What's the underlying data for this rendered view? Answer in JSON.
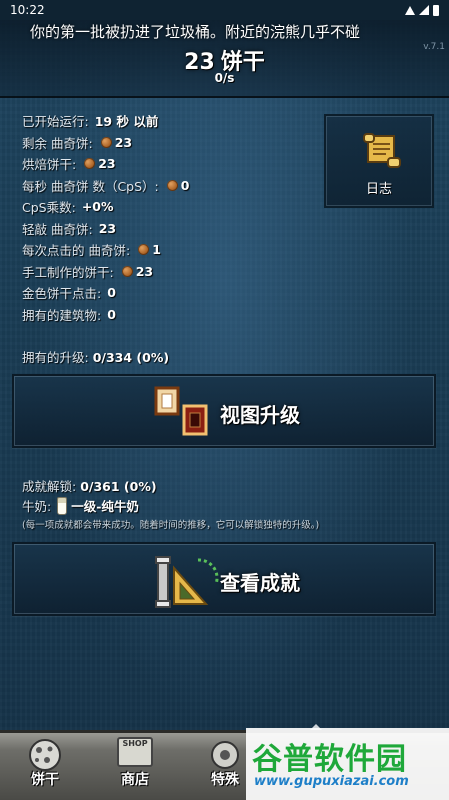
{
  "status_bar": {
    "time": "10:22"
  },
  "header": {
    "ticker": "你的第一批被扔进了垃圾桶。附近的浣熊几乎不碰",
    "version": "v.7.1",
    "cookie_number": "23",
    "cookie_unit": "饼干",
    "per_second": "0/s"
  },
  "stats": [
    {
      "label": "已开始运行:",
      "value": "19 秒 以前",
      "cookie_icon": false
    },
    {
      "label": "剩余 曲奇饼:",
      "value": "23",
      "cookie_icon": true
    },
    {
      "label": "烘焙饼干:",
      "value": "23",
      "cookie_icon": true
    },
    {
      "label": "每秒 曲奇饼 数（CpS）:",
      "value": "0",
      "cookie_icon": true
    },
    {
      "label": "CpS乘数:",
      "value": "+0%",
      "cookie_icon": false
    },
    {
      "label": "轻敲 曲奇饼:",
      "value": "23",
      "cookie_icon": false
    },
    {
      "label": "每次点击的 曲奇饼:",
      "value": "1",
      "cookie_icon": true
    },
    {
      "label": "手工制作的饼干:",
      "value": "23",
      "cookie_icon": true
    },
    {
      "label": "金色饼干点击:",
      "value": "0",
      "cookie_icon": false
    },
    {
      "label": "拥有的建筑物:",
      "value": "0",
      "cookie_icon": false
    }
  ],
  "log_button": {
    "label": "日志",
    "icon": "scroll-icon"
  },
  "upgrades": {
    "label": "拥有的升级:",
    "value": "0/334 (0%)",
    "button_label": "视图升级",
    "icon": "upgrade-frames-icon"
  },
  "achievements": {
    "label": "成就解锁:",
    "value": "0/361 (0%)",
    "milk_label": "牛奶:",
    "milk_value": "一级-纯牛奶",
    "note": "(每一项成就都会带来成功。随着时间的推移，它可以解锁独特的升级。)",
    "button_label": "查看成就",
    "icon": "trophy-ruler-icon"
  },
  "bottom_tabs": [
    {
      "label": "饼干",
      "icon": "cookie-icon"
    },
    {
      "label": "商店",
      "icon": "shop-icon",
      "icon_text": "SHOP"
    },
    {
      "label": "特殊",
      "icon": "special-icon"
    }
  ],
  "watermark": {
    "title": "谷普软件园",
    "url": "www.gupuxiazai.com"
  },
  "colors": {
    "background": "#1a3d55",
    "bottom_bar": "#6e6e69",
    "watermark_green": "#1fa83a",
    "watermark_blue": "#1e7fc8"
  }
}
